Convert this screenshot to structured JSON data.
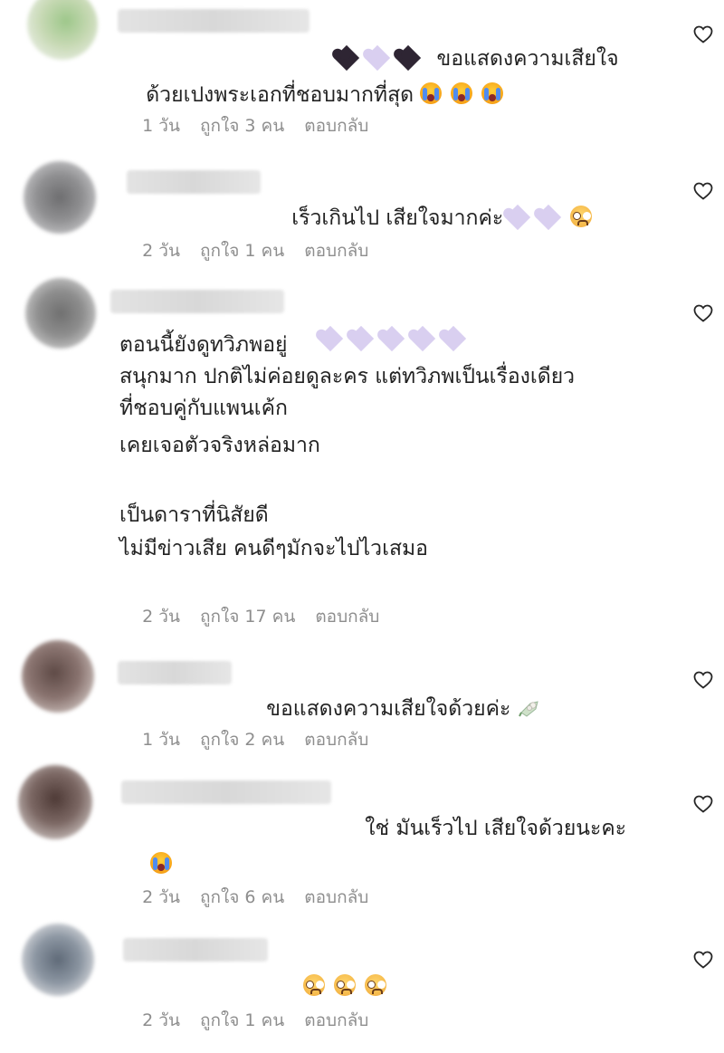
{
  "colors": {
    "text": "#222222",
    "meta": "#8e8e8e",
    "background": "#ffffff",
    "heart_black": "#2e2533",
    "heart_lavender": "#d9cff0"
  },
  "comments": [
    {
      "line1": " ขอแสดงความเสียใจ",
      "line2": "ด้วยเปงพระเอกที่ชอบมากที่สุด",
      "time": "1 วัน",
      "likes": "ถูกใจ 3 คน",
      "reply": "ตอบกลับ"
    },
    {
      "line1": "เร็วเกินไป เสียใจมากค่ะ",
      "time": "2 วัน",
      "likes": "ถูกใจ 1 คน",
      "reply": "ตอบกลับ"
    },
    {
      "lines": [
        "ตอนนี้ยังดูทวิภพอยู่",
        "สนุกมาก ปกติไม่ค่อยดูละคร แต่ทวิภพเป็นเรื่องเดียว",
        "ที่ชอบคู่กับแพนเค้ก",
        "เคยเจอตัวจริงหล่อมาก",
        "",
        "เป็นดาราที่นิสัยดี",
        "ไม่มีข่าวเสีย คนดีๆมักจะไปไวเสมอ"
      ],
      "time": "2 วัน",
      "likes": "ถูกใจ 17 คน",
      "reply": "ตอบกลับ"
    },
    {
      "line1": "ขอแสดงความเสียใจด้วยค่ะ",
      "time": "1 วัน",
      "likes": "ถูกใจ 2 คน",
      "reply": "ตอบกลับ"
    },
    {
      "line1": "ใช่ มันเร็วไป เสียใจด้วยนะคะ",
      "time": "2 วัน",
      "likes": "ถูกใจ 6 คน",
      "reply": "ตอบกลับ"
    },
    {
      "time": "2 วัน",
      "likes": "ถูกใจ 1 คน",
      "reply": "ตอบกลับ"
    }
  ],
  "icons": {
    "like": "heart-outline-icon",
    "emoji_cry": "loudly-crying-face",
    "emoji_plead": "pleading-face",
    "emoji_flower": "bouquet",
    "heart_black": "black-heart",
    "heart_white": "white-heart"
  }
}
